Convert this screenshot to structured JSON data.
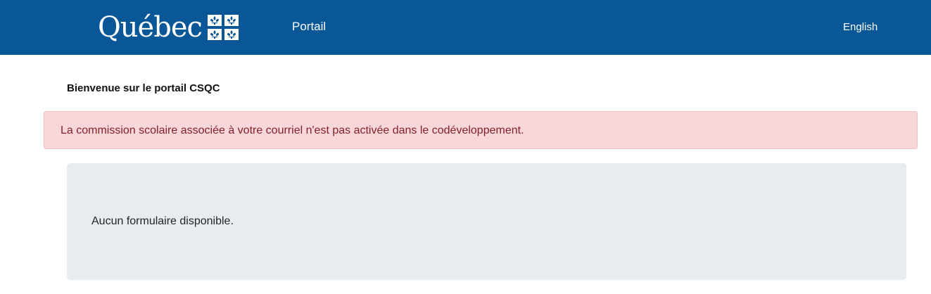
{
  "header": {
    "brand_word": "Québec",
    "brand_icon": "fleur-de-lis-flag-icon",
    "nav_label": "Portail",
    "language_label": "English",
    "background_color": "#095797"
  },
  "main": {
    "welcome_title": "Bienvenue sur le portail CSQC",
    "alert_message": "La commission scolaire associée à votre courriel n'est pas activée dans le codéveloppement.",
    "empty_message": "Aucun formulaire disponible."
  },
  "colors": {
    "alert_background": "#f8d7da",
    "alert_text": "#842029",
    "panel_background": "#e9ecef"
  }
}
